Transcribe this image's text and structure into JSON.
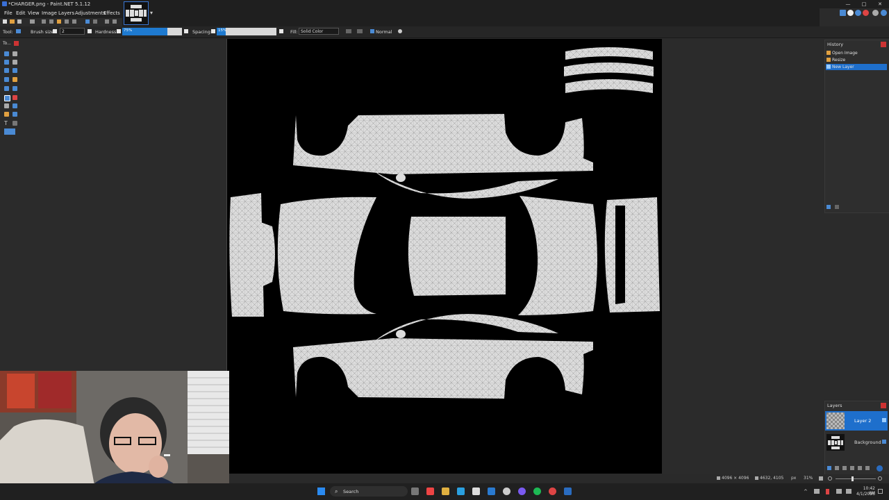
{
  "window": {
    "title": "*CHARGER.png - Paint.NET 5.1.12",
    "minimize_glyph": "—",
    "maximize_glyph": "□",
    "close_glyph": "✕"
  },
  "menu": {
    "items": [
      "File",
      "Edit",
      "View",
      "Image",
      "Layers",
      "Adjustments",
      "Effects"
    ]
  },
  "toolbar": {
    "tool_label": "Tool:",
    "brush_size_label": "Brush size:",
    "brush_size_value": "2",
    "hardness_label": "Hardness:",
    "hardness_value": "75%",
    "hardness_fraction": 0.75,
    "spacing_label": "Spacing:",
    "spacing_value": "15%",
    "spacing_fraction": 0.15,
    "fill_label": "Fill:",
    "fill_value": "Solid Color",
    "blend_mode": "Normal"
  },
  "tools_panel": {
    "title": "To..."
  },
  "history": {
    "title": "History",
    "items": [
      {
        "label": "Open Image",
        "selected": false
      },
      {
        "label": "Resize",
        "selected": false
      },
      {
        "label": "New Layer",
        "selected": true
      }
    ]
  },
  "layers": {
    "title": "Layers",
    "items": [
      {
        "label": "Layer 2",
        "selected": true
      },
      {
        "label": "Background",
        "selected": false
      }
    ]
  },
  "status": {
    "image_size": "4096 × 4096",
    "cursor_pos": "4632, 4105",
    "unit": "px",
    "zoom": "31%"
  },
  "taskbar": {
    "search_label": "Search",
    "time": "10:42 AM",
    "date": "4/1/2026"
  },
  "colors": {
    "accent": "#1e6fcc",
    "canvas": "#000000",
    "panel": "#2b2b2b"
  }
}
